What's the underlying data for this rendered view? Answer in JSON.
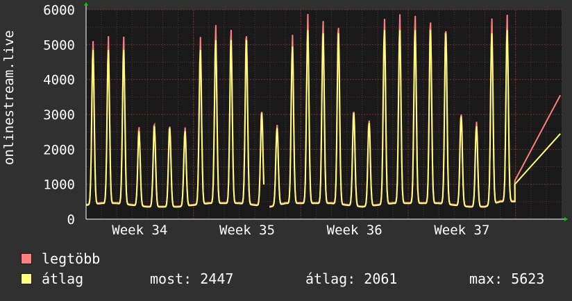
{
  "chart_data": {
    "type": "line",
    "ylabel": "onlinestream.live",
    "ylim": [
      0,
      6000
    ],
    "yticks": [
      0,
      1000,
      2000,
      3000,
      4000,
      5000,
      6000
    ],
    "yticks_labels": [
      "0",
      "1000",
      "2000",
      "3000",
      "4000",
      "5000",
      "6000"
    ],
    "x_weeks": [
      "Week 34",
      "Week 35",
      "Week 36",
      "Week 37"
    ],
    "x_range_days": [
      0,
      31
    ],
    "grid": true,
    "daily_peaks": [
      5100,
      5100,
      5100,
      2650,
      2800,
      2750,
      2650,
      5100,
      5400,
      5400,
      5400,
      3200,
      2750,
      5200,
      5700,
      5600,
      5600,
      3200,
      2900,
      5700,
      5700,
      5700,
      5700,
      5600,
      3100,
      2800,
      5600,
      5700
    ],
    "daily_troughs": [
      400,
      450,
      450,
      400,
      350,
      350,
      350,
      400,
      450,
      450,
      450,
      400,
      350,
      450,
      450,
      450,
      450,
      400,
      350,
      400,
      450,
      450,
      450,
      450,
      400,
      350,
      350,
      500
    ],
    "series": [
      {
        "name": "legtöbb",
        "color": "#ff7f7f"
      },
      {
        "name": "átlag",
        "color": "#ffff7f"
      }
    ],
    "gaps_days": [
      [
        11.6,
        11.95
      ]
    ],
    "last_value_max": 3550,
    "last_value_avg": 2447
  },
  "legend": {
    "max_label": "legtöbb",
    "avg_label": "átlag",
    "max_color": "#ff7f7f",
    "avg_color": "#ffff7f"
  },
  "stats": {
    "now": "most: 2447",
    "avg": "átlag: 2061",
    "max": "max: 5623"
  },
  "colors": {
    "background": "#303030",
    "plot_background": "#1a1a1a",
    "grid_minor": "#5a3535",
    "grid_major": "#7a3030",
    "axis": "#ffffff"
  }
}
